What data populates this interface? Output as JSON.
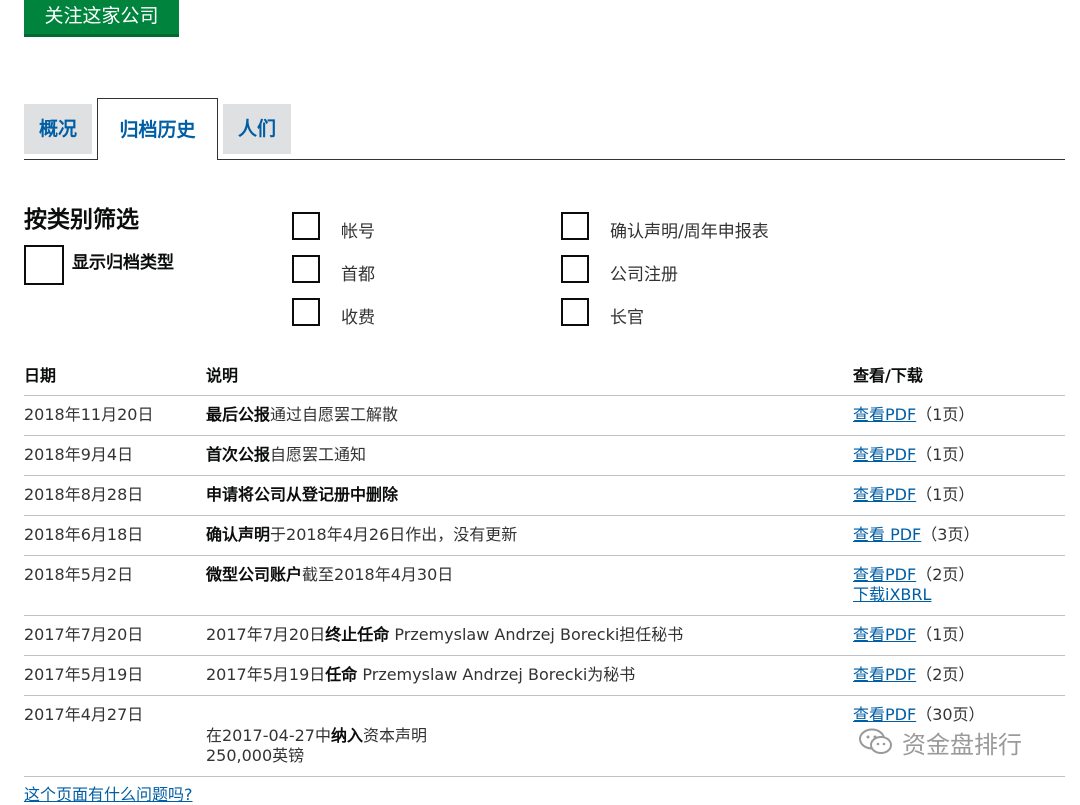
{
  "follow_button": "关注这家公司",
  "tabs": [
    {
      "label": "概况"
    },
    {
      "label": "归档历史"
    },
    {
      "label": "人们"
    }
  ],
  "filter": {
    "title": "按类别筛选",
    "show_types_label": "显示归档类型",
    "categories": [
      "帐号",
      "首都",
      "收费",
      "确认声明/周年申报表",
      "公司注册",
      "长官"
    ]
  },
  "table": {
    "headers": [
      "日期",
      "说明",
      "查看/下载"
    ],
    "rows": [
      {
        "date": "2018年11月20日",
        "desc_bold": "最后公报",
        "desc_rest": "通过自愿罢工解散",
        "link": "查看PDF",
        "pages": "（1页）"
      },
      {
        "date": "2018年9月4日",
        "desc_bold": "首次公报",
        "desc_rest": "自愿罢工通知",
        "link": "查看PDF",
        "pages": "（1页）"
      },
      {
        "date": "2018年8月28日",
        "desc_bold": "申请将公司从登记册中删除",
        "desc_rest": "",
        "link": "查看PDF",
        "pages": "（1页）"
      },
      {
        "date": "2018年6月18日",
        "desc_bold": "确认声明",
        "desc_rest": "于2018年4月26日作出，没有更新",
        "link": "查看 PDF",
        "pages": "（3页）"
      },
      {
        "date": "2018年5月2日",
        "desc_bold": "微型公司账户",
        "desc_rest": "截至2018年4月30日",
        "link": "查看PDF",
        "pages": "（2页）",
        "link2": "下载iXBRL"
      },
      {
        "date": "2017年7月20日",
        "desc_pre": "2017年7月20日",
        "desc_bold": "终止任命",
        "desc_rest": " Przemyslaw Andrzej Borecki担任秘书",
        "link": "查看PDF",
        "pages": "（1页）"
      },
      {
        "date": "2017年5月19日",
        "desc_pre": "2017年5月19日",
        "desc_bold": "任命",
        "desc_rest": " Przemyslaw Andrzej Borecki为秘书",
        "link": "查看PDF",
        "pages": "（2页）"
      },
      {
        "date": "2017年4月27日",
        "desc_pre": "在2017-04-27中",
        "desc_bold": "纳入",
        "desc_rest": "资本声明",
        "desc_line2": "250,000英镑",
        "link": "查看PDF",
        "pages": "（30页）"
      }
    ]
  },
  "bottom_link": "这个页面有什么问题吗?",
  "watermark": "资金盘排行",
  "colors": {
    "follow_green": "#00843d",
    "link_blue": "#005ea5",
    "tab_gray": "#dee0e2"
  }
}
